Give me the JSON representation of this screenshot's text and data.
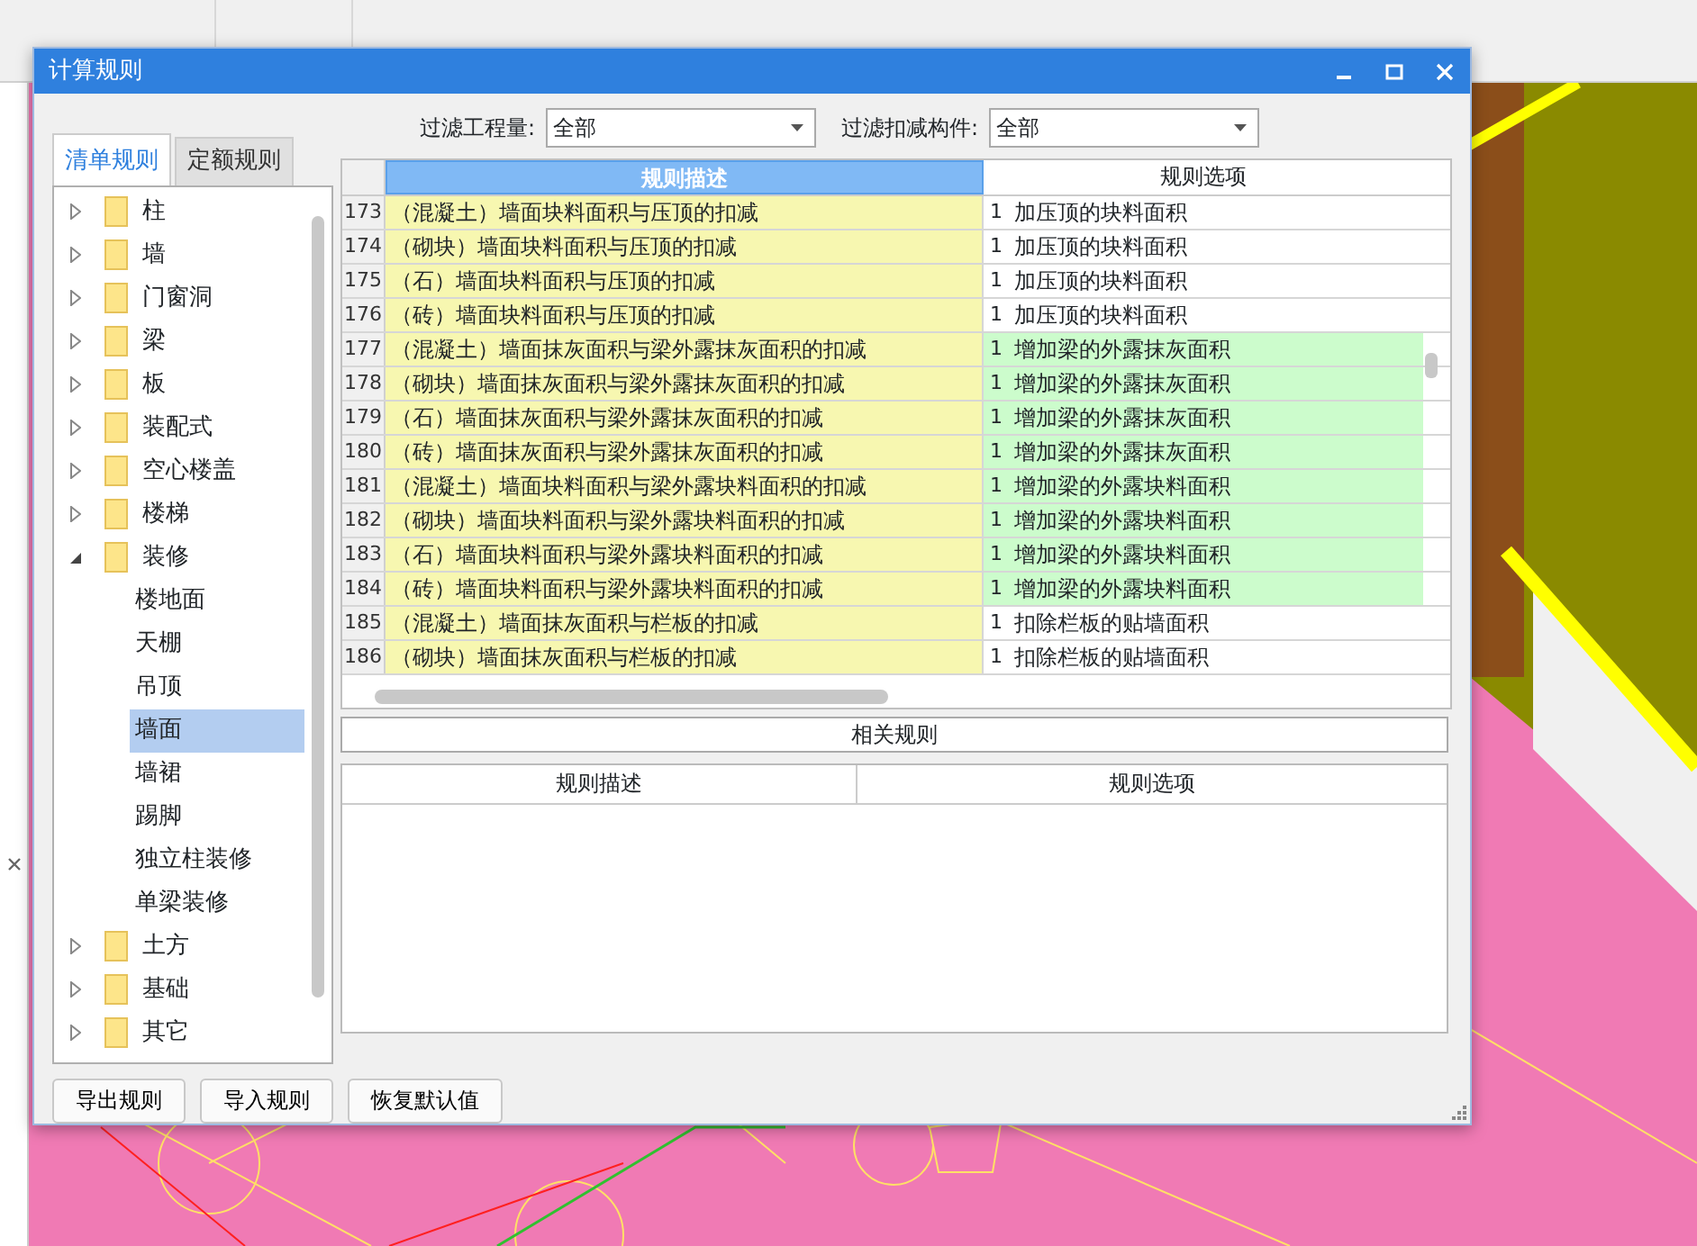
{
  "window": {
    "title": "计算规则"
  },
  "tabs": [
    {
      "label": "清单规则",
      "selected": true
    },
    {
      "label": "定额规则",
      "selected": false
    }
  ],
  "filters": [
    {
      "label": "过滤工程量:",
      "value": "全部"
    },
    {
      "label": "过滤扣减构件:",
      "value": "全部"
    }
  ],
  "tree": [
    {
      "label": "柱",
      "expanded": false,
      "selected": false
    },
    {
      "label": "墙",
      "expanded": false,
      "selected": false
    },
    {
      "label": "门窗洞",
      "expanded": false,
      "selected": false
    },
    {
      "label": "梁",
      "expanded": false,
      "selected": false
    },
    {
      "label": "板",
      "expanded": false,
      "selected": false
    },
    {
      "label": "装配式",
      "expanded": false,
      "selected": false
    },
    {
      "label": "空心楼盖",
      "expanded": false,
      "selected": false
    },
    {
      "label": "楼梯",
      "expanded": false,
      "selected": false
    },
    {
      "label": "装修",
      "expanded": true,
      "selected": false,
      "children": [
        {
          "label": "楼地面",
          "selected": false
        },
        {
          "label": "天棚",
          "selected": false
        },
        {
          "label": "吊顶",
          "selected": false
        },
        {
          "label": "墙面",
          "selected": true
        },
        {
          "label": "墙裙",
          "selected": false
        },
        {
          "label": "踢脚",
          "selected": false
        },
        {
          "label": "独立柱装修",
          "selected": false
        },
        {
          "label": "单梁装修",
          "selected": false
        }
      ]
    },
    {
      "label": "土方",
      "expanded": false,
      "selected": false
    },
    {
      "label": "基础",
      "expanded": false,
      "selected": false
    },
    {
      "label": "其它",
      "expanded": false,
      "selected": false
    }
  ],
  "table": {
    "columns": [
      {
        "label": "规则描述",
        "selected": true
      },
      {
        "label": "规则选项",
        "selected": false
      }
    ],
    "rows": [
      {
        "number": "173",
        "description": "（混凝土）墙面块料面积与压顶的扣减",
        "option_number": "1",
        "option": "加压顶的块料面积",
        "highlighted": false
      },
      {
        "number": "174",
        "description": "（砌块）墙面块料面积与压顶的扣减",
        "option_number": "1",
        "option": "加压顶的块料面积",
        "highlighted": false
      },
      {
        "number": "175",
        "description": "（石）墙面块料面积与压顶的扣减",
        "option_number": "1",
        "option": "加压顶的块料面积",
        "highlighted": false
      },
      {
        "number": "176",
        "description": "（砖）墙面块料面积与压顶的扣减",
        "option_number": "1",
        "option": "加压顶的块料面积",
        "highlighted": false
      },
      {
        "number": "177",
        "description": "（混凝土）墙面抹灰面积与梁外露抹灰面积的扣减",
        "option_number": "1",
        "option": "增加梁的外露抹灰面积",
        "highlighted": true
      },
      {
        "number": "178",
        "description": "（砌块）墙面抹灰面积与梁外露抹灰面积的扣减",
        "option_number": "1",
        "option": "增加梁的外露抹灰面积",
        "highlighted": true
      },
      {
        "number": "179",
        "description": "（石）墙面抹灰面积与梁外露抹灰面积的扣减",
        "option_number": "1",
        "option": "增加梁的外露抹灰面积",
        "highlighted": true
      },
      {
        "number": "180",
        "description": "（砖）墙面抹灰面积与梁外露抹灰面积的扣减",
        "option_number": "1",
        "option": "增加梁的外露抹灰面积",
        "highlighted": true
      },
      {
        "number": "181",
        "description": "（混凝土）墙面块料面积与梁外露块料面积的扣减",
        "option_number": "1",
        "option": "增加梁的外露块料面积",
        "highlighted": true
      },
      {
        "number": "182",
        "description": "（砌块）墙面块料面积与梁外露块料面积的扣减",
        "option_number": "1",
        "option": "增加梁的外露块料面积",
        "highlighted": true
      },
      {
        "number": "183",
        "description": "（石）墙面块料面积与梁外露块料面积的扣减",
        "option_number": "1",
        "option": "增加梁的外露块料面积",
        "highlighted": true
      },
      {
        "number": "184",
        "description": "（砖）墙面块料面积与梁外露块料面积的扣减",
        "option_number": "1",
        "option": "增加梁的外露块料面积",
        "highlighted": true
      },
      {
        "number": "185",
        "description": "（混凝土）墙面抹灰面积与栏板的扣减",
        "option_number": "1",
        "option": "扣除栏板的贴墙面积",
        "highlighted": false
      },
      {
        "number": "186",
        "description": "（砌块）墙面抹灰面积与栏板的扣减",
        "option_number": "1",
        "option": "扣除栏板的贴墙面积",
        "highlighted": false
      }
    ]
  },
  "related": {
    "title": "相关规则",
    "columns": [
      "规则描述",
      "规则选项"
    ]
  },
  "buttons": [
    "导出规则",
    "导入规则",
    "恢复默认值"
  ]
}
